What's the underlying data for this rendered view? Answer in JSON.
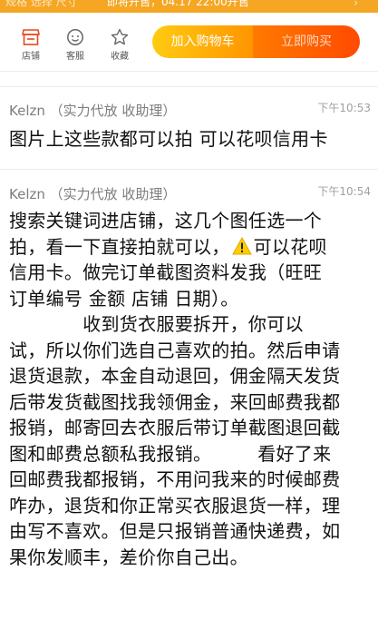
{
  "topbar": {
    "select_text": "规格  选择 尺寸",
    "sale_text": "即将开售，04.17 22:00开售",
    "chevron": "›"
  },
  "actions": {
    "shop_label": "店铺",
    "service_label": "客服",
    "favorite_label": "收藏",
    "add_to_cart": "加入购物车",
    "buy_now": "立即购买"
  },
  "messages": [
    {
      "sender": "Kelzn （实力代放 收助理）",
      "time": "下午10:53",
      "lines": [
        "图片上这些款都可以拍 可以花呗信用卡"
      ]
    },
    {
      "sender": "Kelzn （实力代放 收助理）",
      "time": "下午10:54",
      "lines": [
        "搜索关键词进店铺，这几个图任选一个",
        "拍，看一下直接拍就可以，",
        "可以花呗",
        "信用卡。做完订单截图资料发我（旺旺",
        "订单编号 金额 店铺 日期）。",
        "　　　　收到货衣服要拆开，你可以",
        "试，所以你们选自己喜欢的拍。然后申请",
        "退货退款，本金自动退回，佣金隔天发货",
        "后带发货截图找我领佣金，来回邮费我都",
        "报销，邮寄回去衣服后带订单截图退回截",
        "图和邮费总额私我报销。　　　看好了来",
        "回邮费我都报销，不用问我来的时候邮费",
        "咋办，退货和你正常买衣服退货一样，理",
        "由写不喜欢。但是只报销普通快递费，如",
        "果你发顺丰，差价你自己出。"
      ]
    }
  ],
  "colors": {
    "accent_orange": "#ff9500",
    "warning_yellow": "#ffcc00"
  }
}
